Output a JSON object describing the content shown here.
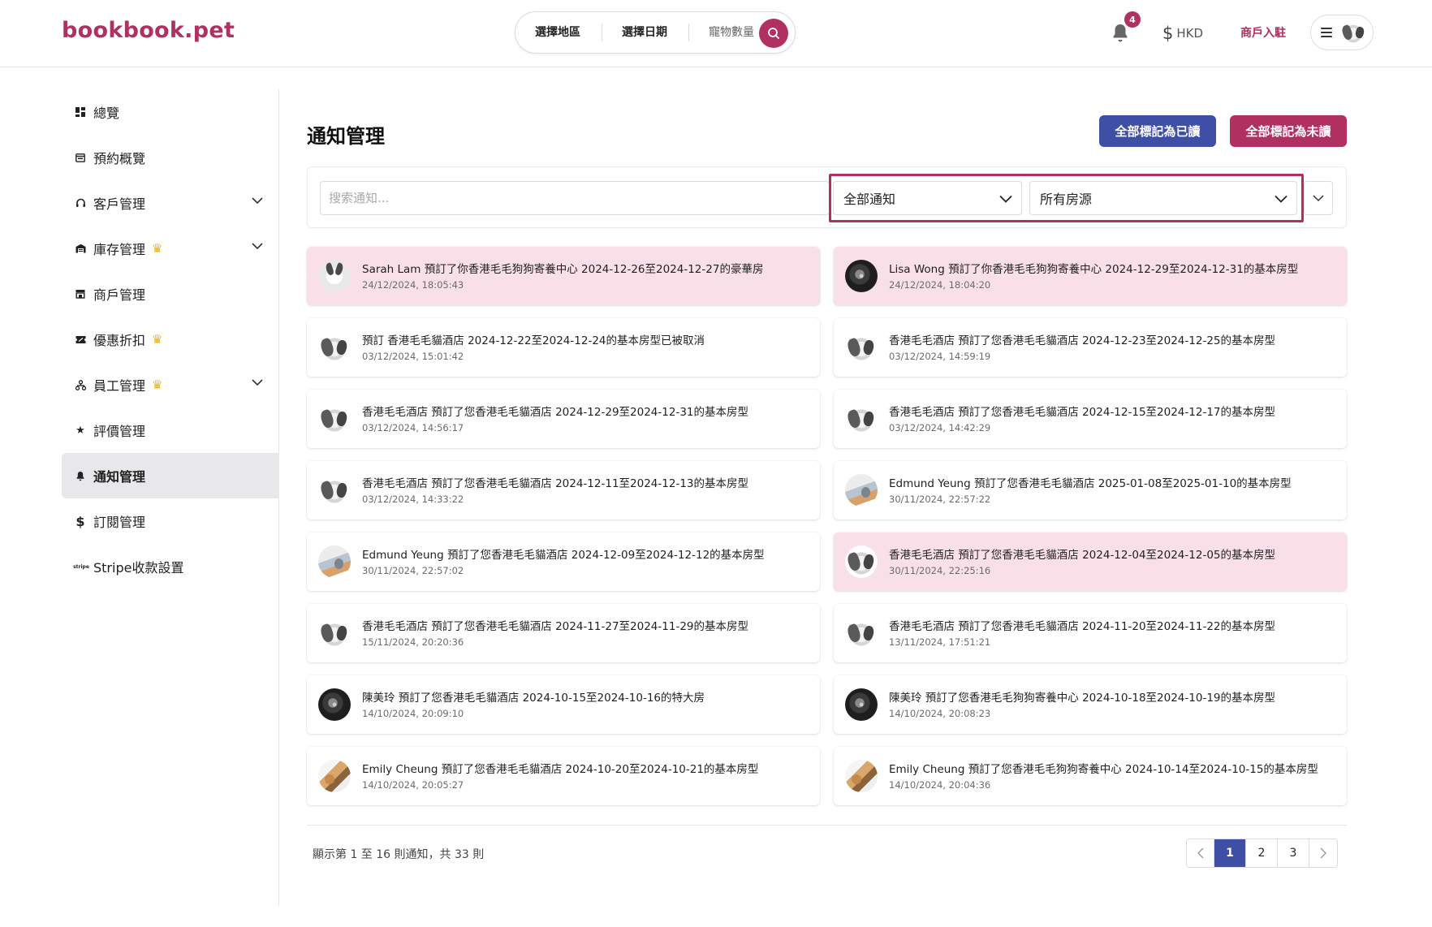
{
  "header": {
    "logo": "bookbook.pet",
    "search": {
      "region": "選擇地區",
      "date": "選擇日期",
      "pets": "寵物數量"
    },
    "notification_count": "4",
    "currency": "HKD",
    "merchant_link": "商戶入駐"
  },
  "sidebar": {
    "items": [
      {
        "label": "總覽"
      },
      {
        "label": "預約概覽"
      },
      {
        "label": "客戶管理"
      },
      {
        "label": "庫存管理"
      },
      {
        "label": "商戶管理"
      },
      {
        "label": "優惠折扣"
      },
      {
        "label": "員工管理"
      },
      {
        "label": "評價管理"
      },
      {
        "label": "通知管理"
      },
      {
        "label": "訂閱管理"
      },
      {
        "label": "Stripe收款設置"
      }
    ]
  },
  "main": {
    "title": "通知管理",
    "mark_all_read": "全部標記為已讀",
    "mark_all_unread": "全部標記為未讀",
    "search_placeholder": "搜索通知...",
    "type_filter": "全部通知",
    "room_filter": "所有房源",
    "notifications": [
      {
        "message": "Sarah Lam 預訂了你香港毛毛狗狗寄養中心 2024-12-26至2024-12-27的豪華房",
        "time": "24/12/2024, 18:05:43"
      },
      {
        "message": "Lisa Wong 預訂了你香港毛毛狗狗寄養中心 2024-12-29至2024-12-31的基本房型",
        "time": "24/12/2024, 18:04:20"
      },
      {
        "message": "預訂 香港毛毛貓酒店 2024-12-22至2024-12-24的基本房型已被取消",
        "time": "03/12/2024, 15:01:42"
      },
      {
        "message": "香港毛毛酒店 預訂了您香港毛毛貓酒店 2024-12-23至2024-12-25的基本房型",
        "time": "03/12/2024, 14:59:19"
      },
      {
        "message": "香港毛毛酒店 預訂了您香港毛毛貓酒店 2024-12-29至2024-12-31的基本房型",
        "time": "03/12/2024, 14:56:17"
      },
      {
        "message": "香港毛毛酒店 預訂了您香港毛毛貓酒店 2024-12-15至2024-12-17的基本房型",
        "time": "03/12/2024, 14:42:29"
      },
      {
        "message": "香港毛毛酒店 預訂了您香港毛毛貓酒店 2024-12-11至2024-12-13的基本房型",
        "time": "03/12/2024, 14:33:22"
      },
      {
        "message": "Edmund Yeung 預訂了您香港毛毛貓酒店 2025-01-08至2025-01-10的基本房型",
        "time": "30/11/2024, 22:57:22"
      },
      {
        "message": "Edmund Yeung 預訂了您香港毛毛貓酒店 2024-12-09至2024-12-12的基本房型",
        "time": "30/11/2024, 22:57:02"
      },
      {
        "message": "香港毛毛酒店 預訂了您香港毛毛貓酒店 2024-12-04至2024-12-05的基本房型",
        "time": "30/11/2024, 22:25:16"
      },
      {
        "message": "香港毛毛酒店 預訂了您香港毛毛貓酒店 2024-11-27至2024-11-29的基本房型",
        "time": "15/11/2024, 20:20:36"
      },
      {
        "message": "香港毛毛酒店 預訂了您香港毛毛貓酒店 2024-11-20至2024-11-22的基本房型",
        "time": "13/11/2024, 17:51:21"
      },
      {
        "message": "陳美玲 預訂了您香港毛毛貓酒店 2024-10-15至2024-10-16的特大房",
        "time": "14/10/2024, 20:09:10"
      },
      {
        "message": "陳美玲 預訂了您香港毛毛狗狗寄養中心 2024-10-18至2024-10-19的基本房型",
        "time": "14/10/2024, 20:08:23"
      },
      {
        "message": "Emily Cheung 預訂了您香港毛毛貓酒店 2024-10-20至2024-10-21的基本房型",
        "time": "14/10/2024, 20:05:27"
      },
      {
        "message": "Emily Cheung 預訂了您香港毛毛狗狗寄養中心 2024-10-14至2024-10-15的基本房型",
        "time": "14/10/2024, 20:04:36"
      }
    ],
    "summary": "顯示第 1 至 16 則通知，共 33 則",
    "pages": [
      "1",
      "2",
      "3"
    ]
  }
}
